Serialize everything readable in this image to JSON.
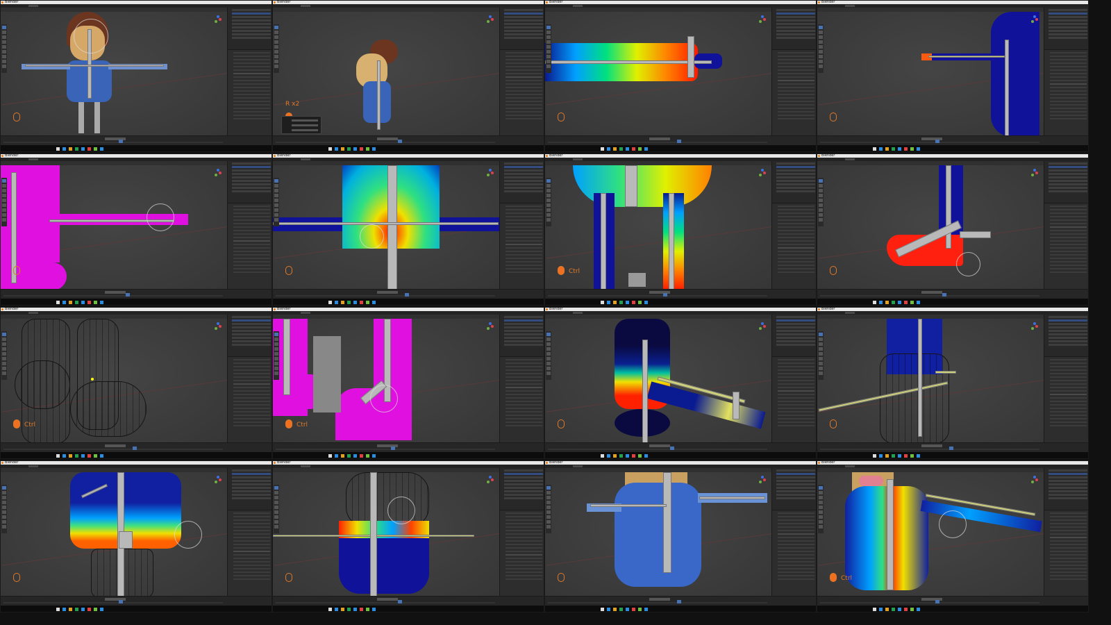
{
  "app": "Blender",
  "overlays": {
    "ctrl": "Ctrl",
    "rotate": "R x2"
  },
  "colors": {
    "accent": "#4772b3",
    "viewport": "#3d3d3d",
    "panel": "#2b2b2b",
    "weight_high": "#ff2a00",
    "weight_low": "#0a0a80",
    "weight_paint_missing": "#ff00ff"
  },
  "tiles": [
    {
      "scene": "char-tpose",
      "overlay": null
    },
    {
      "scene": "char-side",
      "overlay": "rotate"
    },
    {
      "scene": "arm-gradient",
      "overlay": null
    },
    {
      "scene": "arm-blue-body",
      "overlay": null
    },
    {
      "scene": "magenta-arm",
      "overlay": null
    },
    {
      "scene": "torso-gradient",
      "overlay": null
    },
    {
      "scene": "legs-weight",
      "overlay": "ctrl"
    },
    {
      "scene": "foot-weight",
      "overlay": null
    },
    {
      "scene": "wire-feet",
      "overlay": "ctrl"
    },
    {
      "scene": "magenta-feet",
      "overlay": "ctrl"
    },
    {
      "scene": "body-side-weight",
      "overlay": null
    },
    {
      "scene": "wire-body-arm",
      "overlay": null
    },
    {
      "scene": "shirt-weight",
      "overlay": null
    },
    {
      "scene": "pants-weight",
      "overlay": null
    },
    {
      "scene": "shirt-rig",
      "overlay": null
    },
    {
      "scene": "shirt-weight-front",
      "overlay": "ctrl"
    }
  ]
}
